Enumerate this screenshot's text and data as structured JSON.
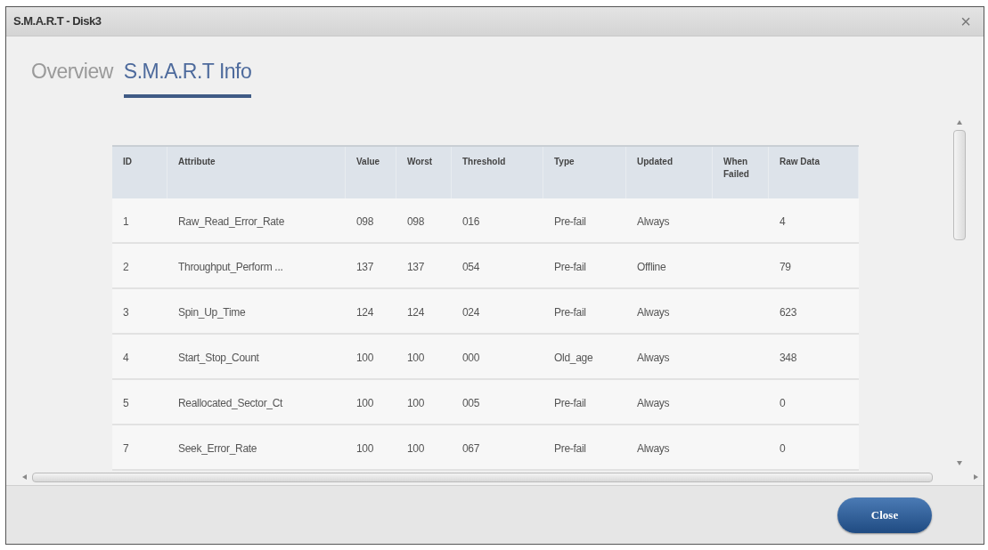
{
  "window": {
    "title": "S.M.A.R.T - Disk3",
    "close_glyph": "×"
  },
  "tabs": [
    {
      "label": "Overview",
      "selected": false
    },
    {
      "label": "S.M.A.R.T Info",
      "selected": true
    }
  ],
  "table": {
    "columns": [
      "ID",
      "Attribute",
      "Value",
      "Worst",
      "Threshold",
      "Type",
      "Updated",
      "When Failed",
      "Raw Data"
    ],
    "rows": [
      {
        "id": "1",
        "attribute": "Raw_Read_Error_Rate",
        "value": "098",
        "worst": "098",
        "threshold": "016",
        "type": "Pre-fail",
        "updated": "Always",
        "raw_data": "4"
      },
      {
        "id": "2",
        "attribute": "Throughput_Perform ...",
        "value": "137",
        "worst": "137",
        "threshold": "054",
        "type": "Pre-fail",
        "updated": "Offline",
        "raw_data": "79"
      },
      {
        "id": "3",
        "attribute": "Spin_Up_Time",
        "value": "124",
        "worst": "124",
        "threshold": "024",
        "type": "Pre-fail",
        "updated": "Always",
        "raw_data": "623"
      },
      {
        "id": "4",
        "attribute": "Start_Stop_Count",
        "value": "100",
        "worst": "100",
        "threshold": "000",
        "type": "Old_age",
        "updated": "Always",
        "raw_data": "348"
      },
      {
        "id": "5",
        "attribute": "Reallocated_Sector_Ct",
        "value": "100",
        "worst": "100",
        "threshold": "005",
        "type": "Pre-fail",
        "updated": "Always",
        "raw_data": "0"
      },
      {
        "id": "7",
        "attribute": "Seek_Error_Rate",
        "value": "100",
        "worst": "100",
        "threshold": "067",
        "type": "Pre-fail",
        "updated": "Always",
        "raw_data": "0"
      }
    ]
  },
  "buttons": [
    "Close"
  ]
}
